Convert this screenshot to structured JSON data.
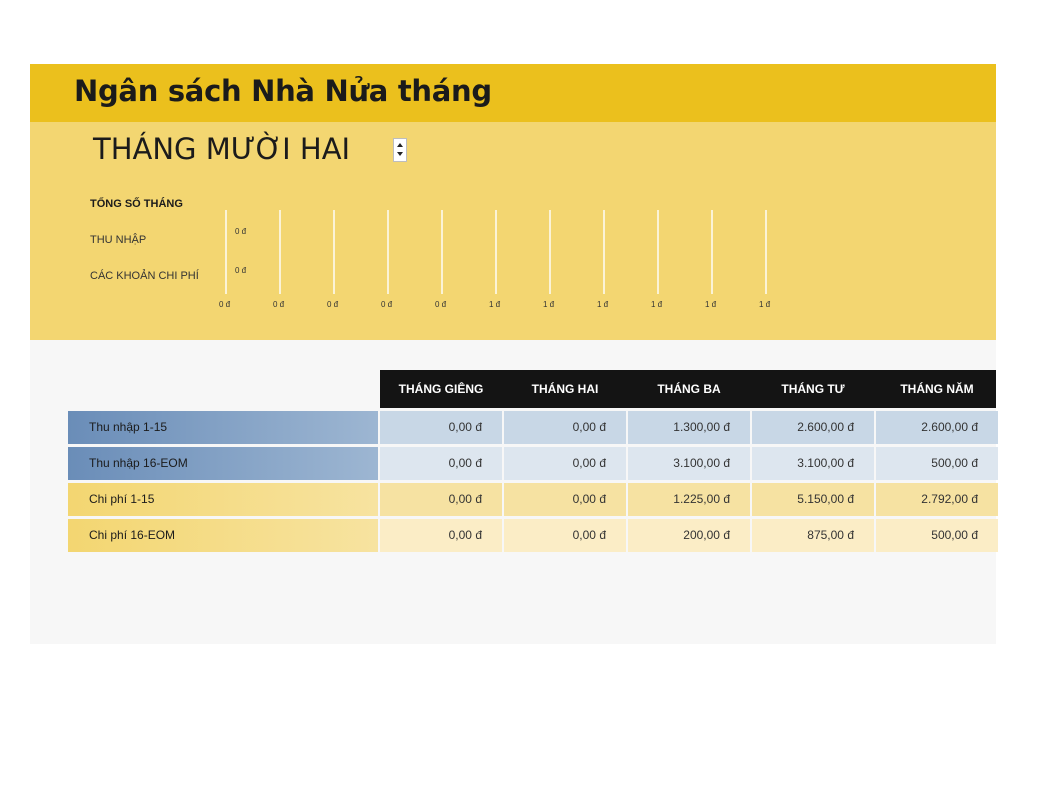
{
  "title": "Ngân sách Nhà Nửa tháng",
  "month": {
    "selected": "THÁNG MƯỜI HAI"
  },
  "summary": {
    "heading": "TỔNG SỐ THÁNG",
    "income_label": "THU NHẬP",
    "expense_label": "CÁC KHOẢN CHI PHÍ",
    "income_value": "0 đ",
    "expense_value": "0 đ",
    "axis_ticks": [
      "0 đ",
      "0 đ",
      "0 đ",
      "0 đ",
      "0 đ",
      "1 đ",
      "1 đ",
      "1 đ",
      "1 đ",
      "1 đ",
      "1 đ"
    ]
  },
  "table": {
    "columns": [
      "THÁNG GIÊNG",
      "THÁNG HAI",
      "THÁNG BA",
      "THÁNG TƯ",
      "THÁNG NĂM"
    ],
    "rows": [
      {
        "label": "Thu nhập 1-15",
        "values": [
          "0,00 đ",
          "0,00 đ",
          "1.300,00 đ",
          "2.600,00 đ",
          "2.600,00 đ"
        ]
      },
      {
        "label": "Thu nhập 16-EOM",
        "values": [
          "0,00 đ",
          "0,00 đ",
          "3.100,00 đ",
          "3.100,00 đ",
          "500,00 đ"
        ]
      },
      {
        "label": "Chi phí 1-15",
        "values": [
          "0,00 đ",
          "0,00 đ",
          "1.225,00 đ",
          "5.150,00 đ",
          "2.792,00 đ"
        ]
      },
      {
        "label": "Chi phí 16-EOM",
        "values": [
          "0,00 đ",
          "0,00 đ",
          "200,00 đ",
          "875,00 đ",
          "500,00 đ"
        ]
      }
    ]
  },
  "colors": {
    "title_band": "#ebc01d",
    "summary_band": "#f3d671",
    "income_label_bg": [
      "#6a8db8",
      "#9db6d2"
    ],
    "income_cell_bg": [
      "#c8d7e6",
      "#dde6ef"
    ],
    "expense_label_bg": [
      "#f3d671",
      "#f7e3a0"
    ],
    "expense_cell_bg": [
      "#f6e2a2",
      "#fbedc6"
    ]
  }
}
